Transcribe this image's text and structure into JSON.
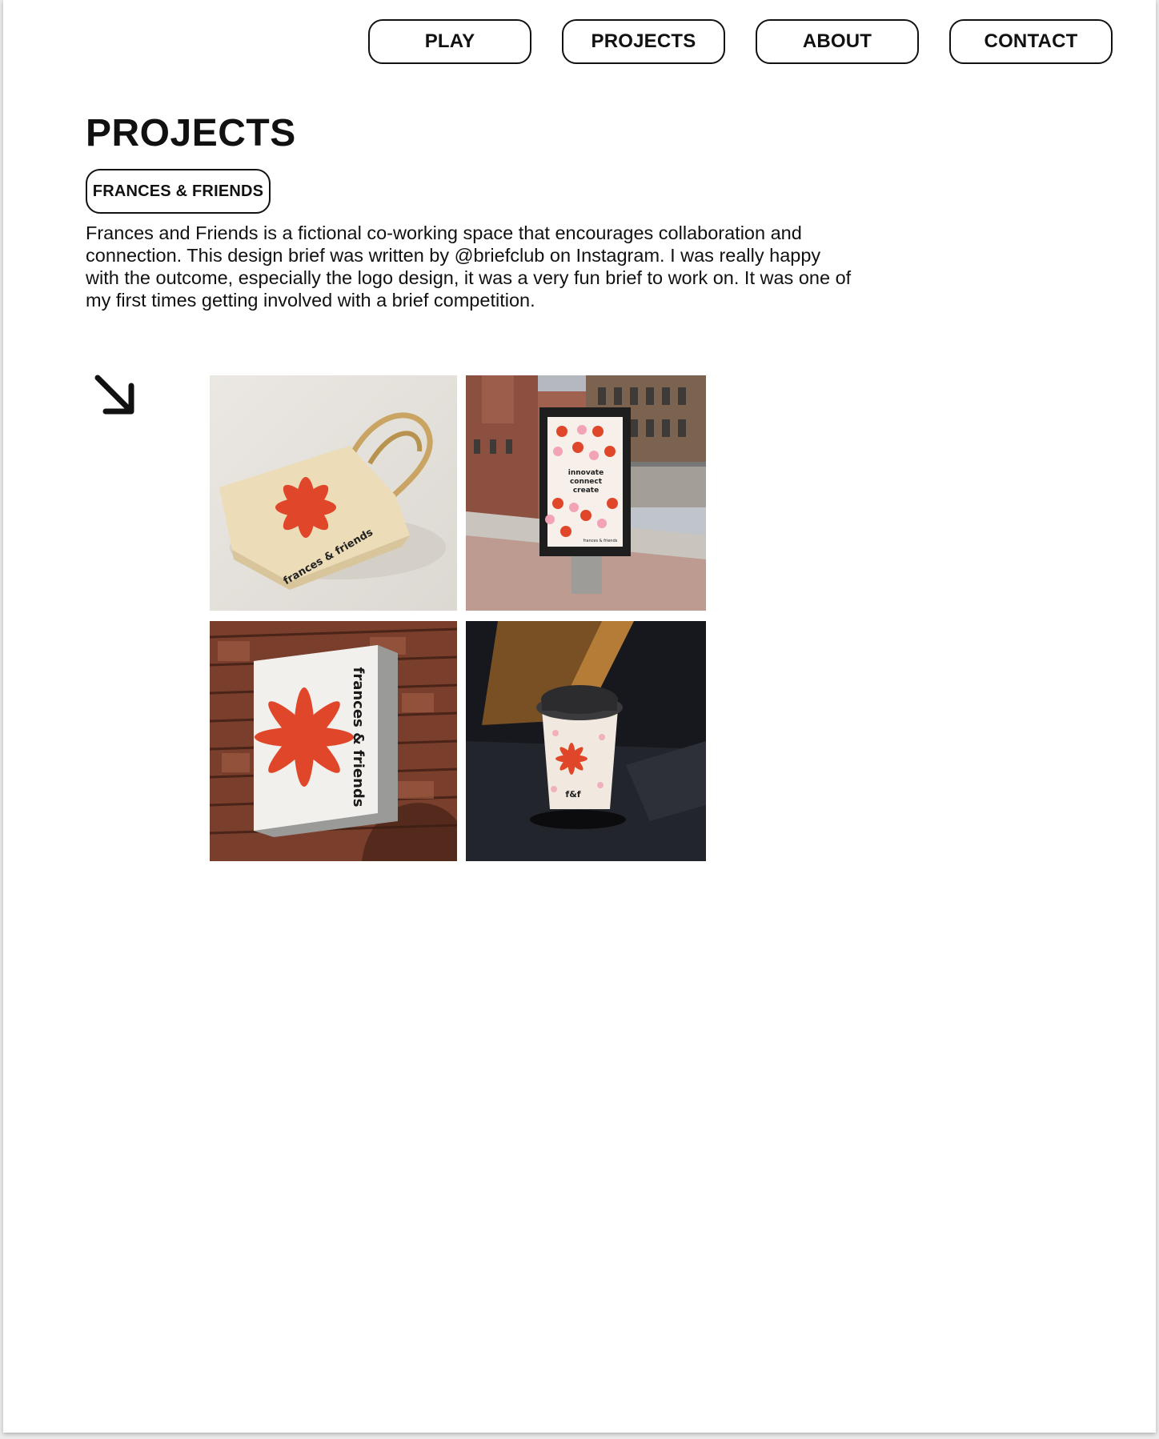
{
  "nav": {
    "play": "PLAY",
    "projects": "PROJECTS",
    "about": "ABOUT",
    "contact": "CONTACT"
  },
  "page_title": "PROJECTS",
  "project": {
    "name": "FRANCES & FRIENDS",
    "description": "Frances and Friends is a fictional co-working space that encourages collaboration and connection. This design brief was written by @briefclub on Instagram. I was really happy with the outcome, especially the logo design, it was a very fun brief to work on. It was one of my first times getting involved with a brief competition."
  },
  "gallery": {
    "tote_brand_text": "frances & friends",
    "poster_lines": [
      "innovate",
      "connect",
      "create"
    ],
    "poster_footer": "frances & friends",
    "sign_text": "frances & friends",
    "cup_text": "f&f"
  },
  "colors": {
    "brand_red": "#e0462a",
    "brand_pink": "#f2a3b5"
  },
  "icons": {
    "arrow": "arrow-down-right-icon"
  }
}
